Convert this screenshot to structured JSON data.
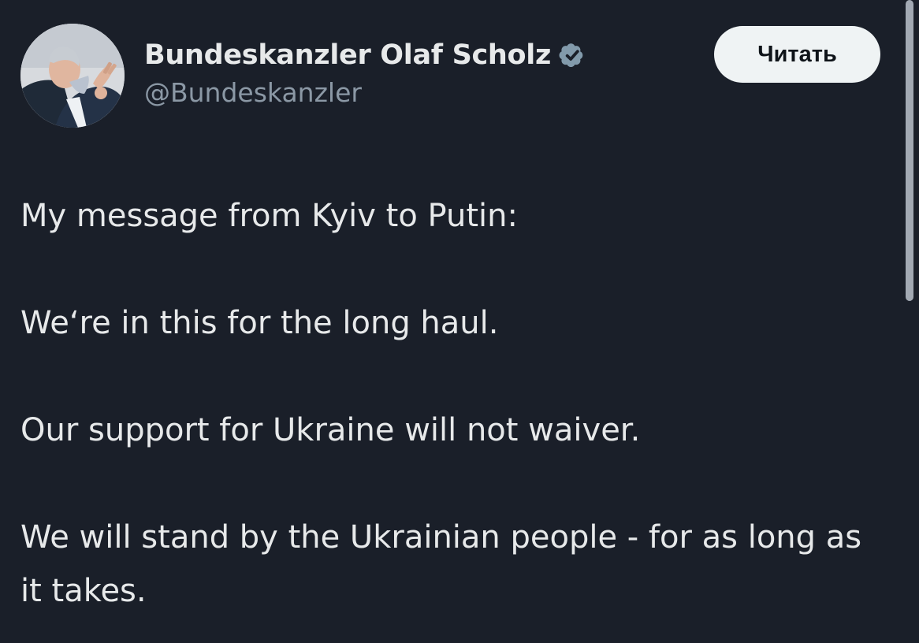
{
  "author": {
    "display_name": "Bundeskanzler Olaf Scholz",
    "handle": "@Bundeskanzler",
    "verified_icon": "verified-badge-icon",
    "avatar": "avatar-photo"
  },
  "actions": {
    "follow_label": "Читать"
  },
  "tweet": {
    "paragraphs": [
      "My message from Kyiv to Putin:",
      "We‘re in this for the long haul.",
      "Our support for Ukraine will not waiver.",
      "We will stand by the Ukrainian people - for as long as it takes."
    ]
  },
  "colors": {
    "background": "#1a1f29",
    "text": "#e7e9ea",
    "secondary_text": "#8b98a5",
    "button_bg": "#eff3f4",
    "verified_badge": "#829aab"
  }
}
